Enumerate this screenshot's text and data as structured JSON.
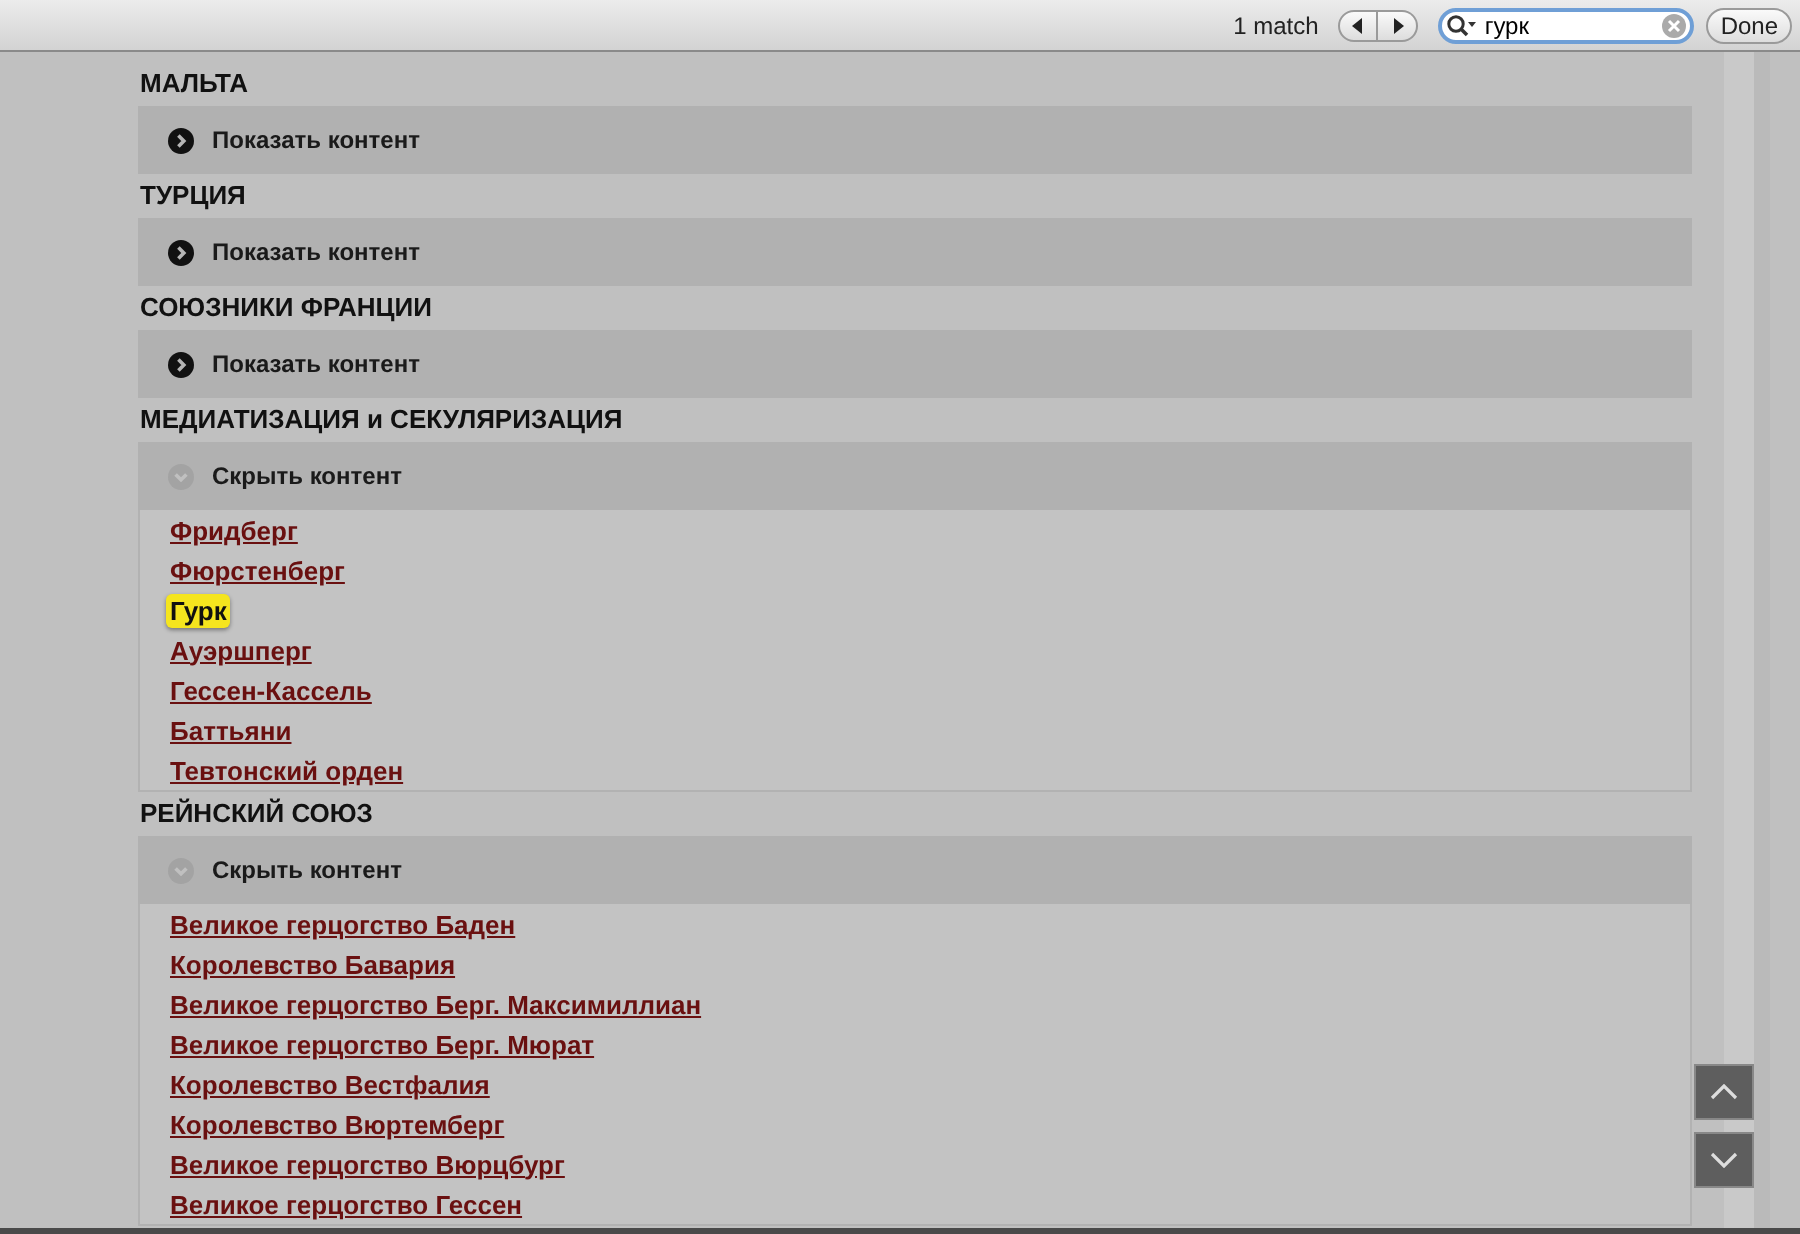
{
  "find_bar": {
    "match_count": "1 match",
    "search": {
      "value": "гурк"
    },
    "done": "Done"
  },
  "sections": [
    {
      "title": "МАЛЬТА",
      "toggle": {
        "label": "Показать контент",
        "expanded": false
      }
    },
    {
      "title": "ТУРЦИЯ",
      "toggle": {
        "label": "Показать контент",
        "expanded": false
      }
    },
    {
      "title": "СОЮЗНИКИ ФРАНЦИИ",
      "toggle": {
        "label": "Показать контент",
        "expanded": false
      }
    },
    {
      "title": "МЕДИАТИЗАЦИЯ и СЕКУЛЯРИЗАЦИЯ",
      "toggle": {
        "label": "Скрыть контент",
        "expanded": true
      },
      "links": [
        {
          "text": "Фридберг",
          "highlighted": false
        },
        {
          "text": "Фюрстенберг",
          "highlighted": false
        },
        {
          "text": "Гурк",
          "highlighted": true
        },
        {
          "text": "Ауэршперг",
          "highlighted": false
        },
        {
          "text": "Гессен-Кассель",
          "highlighted": false
        },
        {
          "text": "Баттьяни",
          "highlighted": false
        },
        {
          "text": "Тевтонский орден",
          "highlighted": false
        }
      ]
    },
    {
      "title": "РЕЙНСКИЙ СОЮЗ",
      "toggle": {
        "label": "Скрыть контент",
        "expanded": true
      },
      "links": [
        {
          "text": "Великое герцогство Баден",
          "highlighted": false
        },
        {
          "text": "Королевство Бавария",
          "highlighted": false
        },
        {
          "text": "Великое герцогство Берг. Максимиллиан",
          "highlighted": false
        },
        {
          "text": "Великое герцогство Берг. Мюрат",
          "highlighted": false
        },
        {
          "text": "Королевство Вестфалия",
          "highlighted": false
        },
        {
          "text": "Королевство Вюртемберг",
          "highlighted": false
        },
        {
          "text": "Великое герцогство Вюрцбург",
          "highlighted": false
        },
        {
          "text": "Великое герцогство Гессен",
          "highlighted": false
        }
      ]
    }
  ]
}
